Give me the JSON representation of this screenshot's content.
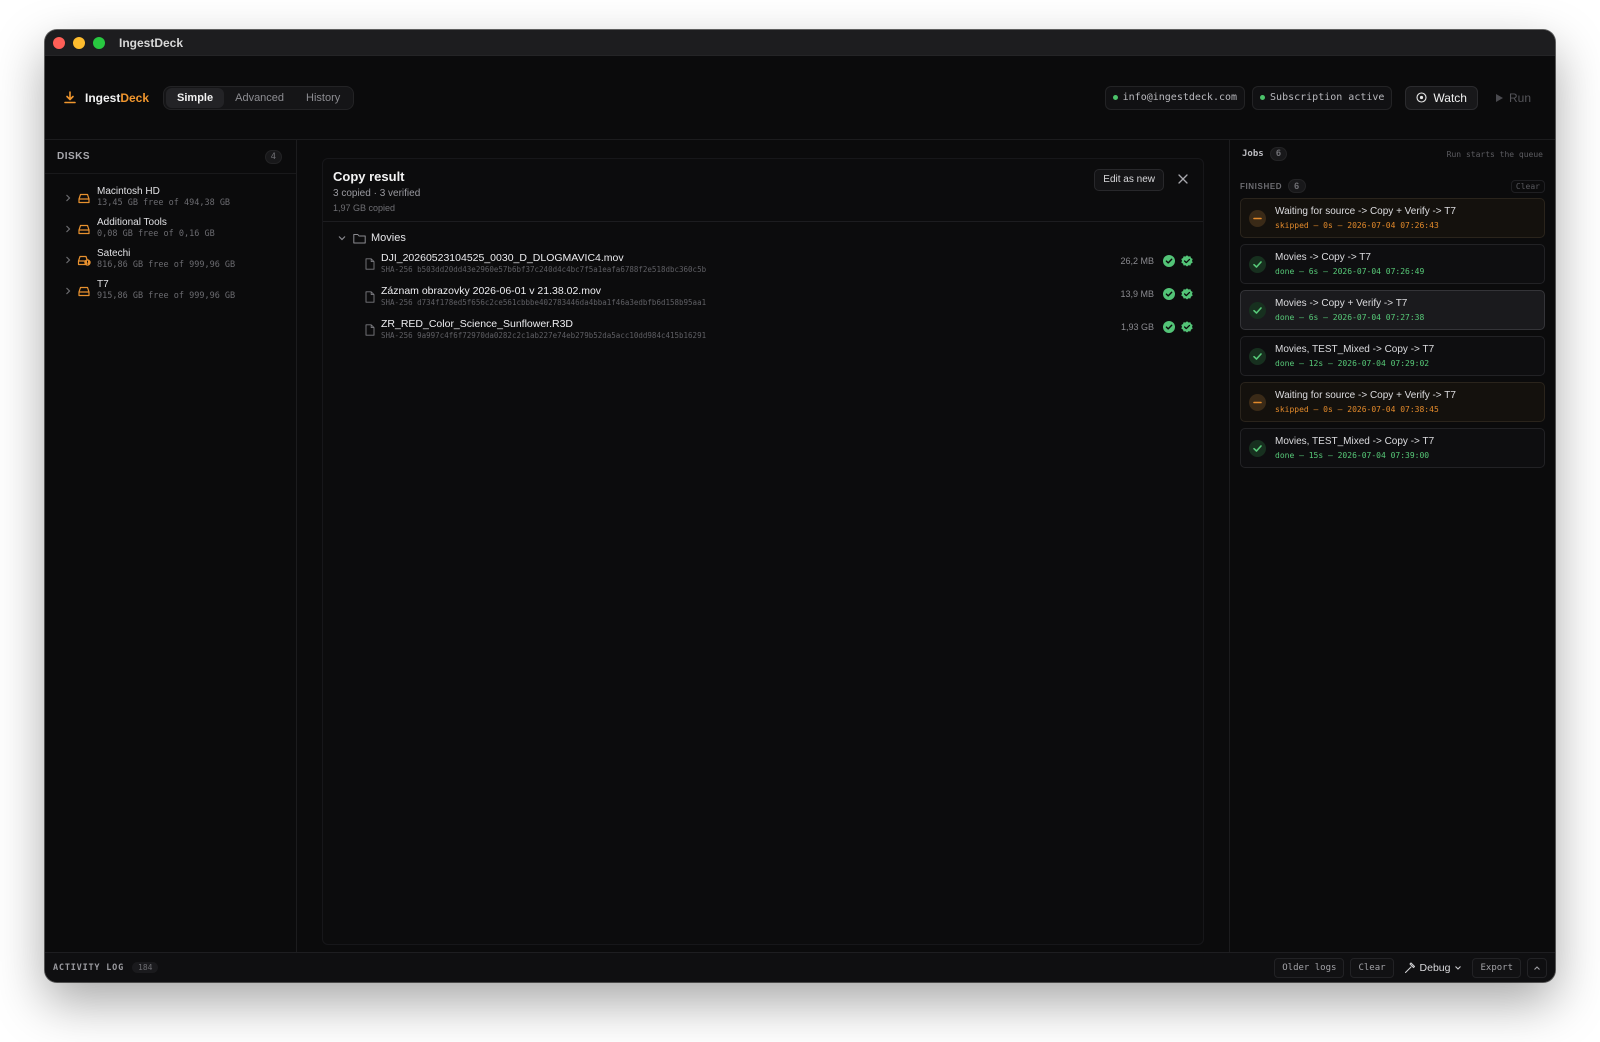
{
  "window": {
    "title": "IngestDeck"
  },
  "brand": {
    "name_main": "Ingest",
    "name_accent": "Deck",
    "accent_color": "#f0962e"
  },
  "modes": [
    {
      "label": "Simple",
      "active": true
    },
    {
      "label": "Advanced",
      "active": false
    },
    {
      "label": "History",
      "active": false
    }
  ],
  "account": {
    "email": "info@ingestdeck.com",
    "subscription": "Subscription active"
  },
  "actions": {
    "watch_label": "Watch",
    "run_label": "Run"
  },
  "disks": {
    "title": "DISKS",
    "count": "4",
    "items": [
      {
        "name": "Macintosh HD",
        "free": "13,45 GB free of 494,38 GB",
        "icon": "drive-icon"
      },
      {
        "name": "Additional Tools",
        "free": "0,08 GB free of 0,16 GB",
        "icon": "drive-icon"
      },
      {
        "name": "Satechi",
        "free": "816,86 GB free of 999,96 GB",
        "icon": "drive-warning-icon"
      },
      {
        "name": "T7",
        "free": "915,86 GB free of 999,96 GB",
        "icon": "drive-icon"
      }
    ]
  },
  "copy_result": {
    "title": "Copy result",
    "summary": "3 copied · 3 verified",
    "total": "1,97 GB copied",
    "edit_label": "Edit as new",
    "folder": "Movies",
    "files": [
      {
        "name": "DJI_20260523104525_0030_D_DLOGMAVIC4.mov",
        "hash": "SHA-256 b503dd20dd43e2960e57b6bf37c240d4c4bc7f5a1eafa6788f2e518dbc360c5b",
        "size": "26,2 MB"
      },
      {
        "name": "Záznam obrazovky 2026-06-01 v 21.38.02.mov",
        "hash": "SHA-256 d734f178ed5f656c2ce561cbbbe402783446da4bba1f46a3edbfb6d158b95aa1",
        "size": "13,9 MB"
      },
      {
        "name": "ZR_RED_Color_Science_Sunflower.R3D",
        "hash": "SHA-256 9a997c4f6f72970da0282c2c1ab227e74eb279b52da5acc10dd984c415b16291",
        "size": "1,93 GB"
      }
    ]
  },
  "jobs": {
    "title": "Jobs",
    "count": "6",
    "hint": "Run starts the queue",
    "finished_label": "FINISHED",
    "finished_count": "6",
    "clear_label": "Clear",
    "items": [
      {
        "title": "Waiting for source -> Copy + Verify -> T7",
        "meta": "skipped — 0s — 2026-07-04 07:26:43",
        "status": "skipped"
      },
      {
        "title": "Movies -> Copy -> T7",
        "meta": "done — 6s — 2026-07-04 07:26:49",
        "status": "done"
      },
      {
        "title": "Movies -> Copy + Verify -> T7",
        "meta": "done — 6s — 2026-07-04 07:27:38",
        "status": "done",
        "selected": true
      },
      {
        "title": "Movies, TEST_Mixed -> Copy -> T7",
        "meta": "done — 12s — 2026-07-04 07:29:02",
        "status": "done"
      },
      {
        "title": "Waiting for source -> Copy + Verify -> T7",
        "meta": "skipped — 0s — 2026-07-04 07:38:45",
        "status": "skipped"
      },
      {
        "title": "Movies, TEST_Mixed -> Copy -> T7",
        "meta": "done — 15s — 2026-07-04 07:39:00",
        "status": "done"
      }
    ]
  },
  "activity_log": {
    "title": "ACTIVITY LOG",
    "count": "184",
    "older_label": "Older logs",
    "clear_label": "Clear",
    "debug_label": "Debug",
    "export_label": "Export"
  }
}
